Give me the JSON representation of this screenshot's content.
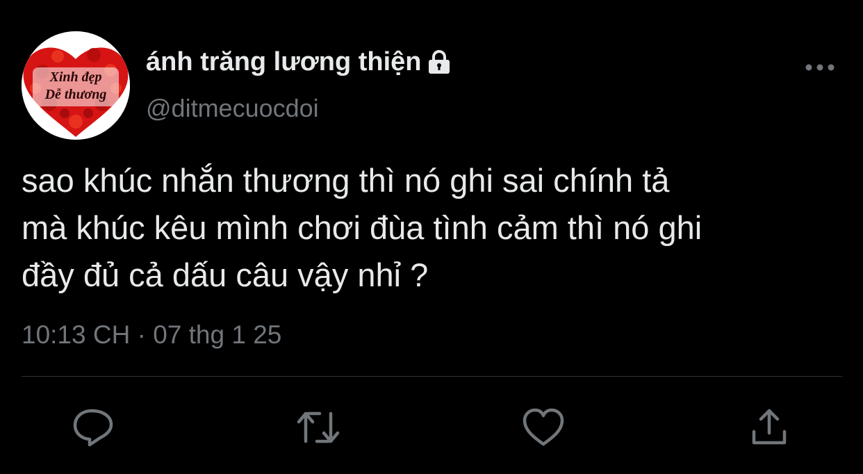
{
  "profile": {
    "display_name": "ánh trăng lương thiện",
    "handle": "@ditmecuocdoi",
    "avatar_text_line1": "Xinh đẹp",
    "avatar_text_line2": "Dễ thương",
    "avatar_colors": {
      "background": "#ffffff",
      "heart": "#d61414"
    }
  },
  "tweet": {
    "text_lines": [
      "sao khúc nhắn thương thì nó ghi sai chính tả",
      "mà khúc kêu mình chơi đùa tình cảm thì nó ghi",
      "đầy đủ cả dấu câu vậy nhỉ ?"
    ],
    "timestamp": "10:13 CH · 07 thg 1 25"
  },
  "icons": {
    "lock": "lock-icon",
    "more": "more-icon",
    "reply": "reply-icon",
    "retweet": "retweet-icon",
    "like": "heart-icon",
    "share": "share-icon"
  },
  "colors": {
    "background": "#000000",
    "text": "#e7e9ea",
    "secondary": "#71767b",
    "divider": "#2f3336"
  }
}
